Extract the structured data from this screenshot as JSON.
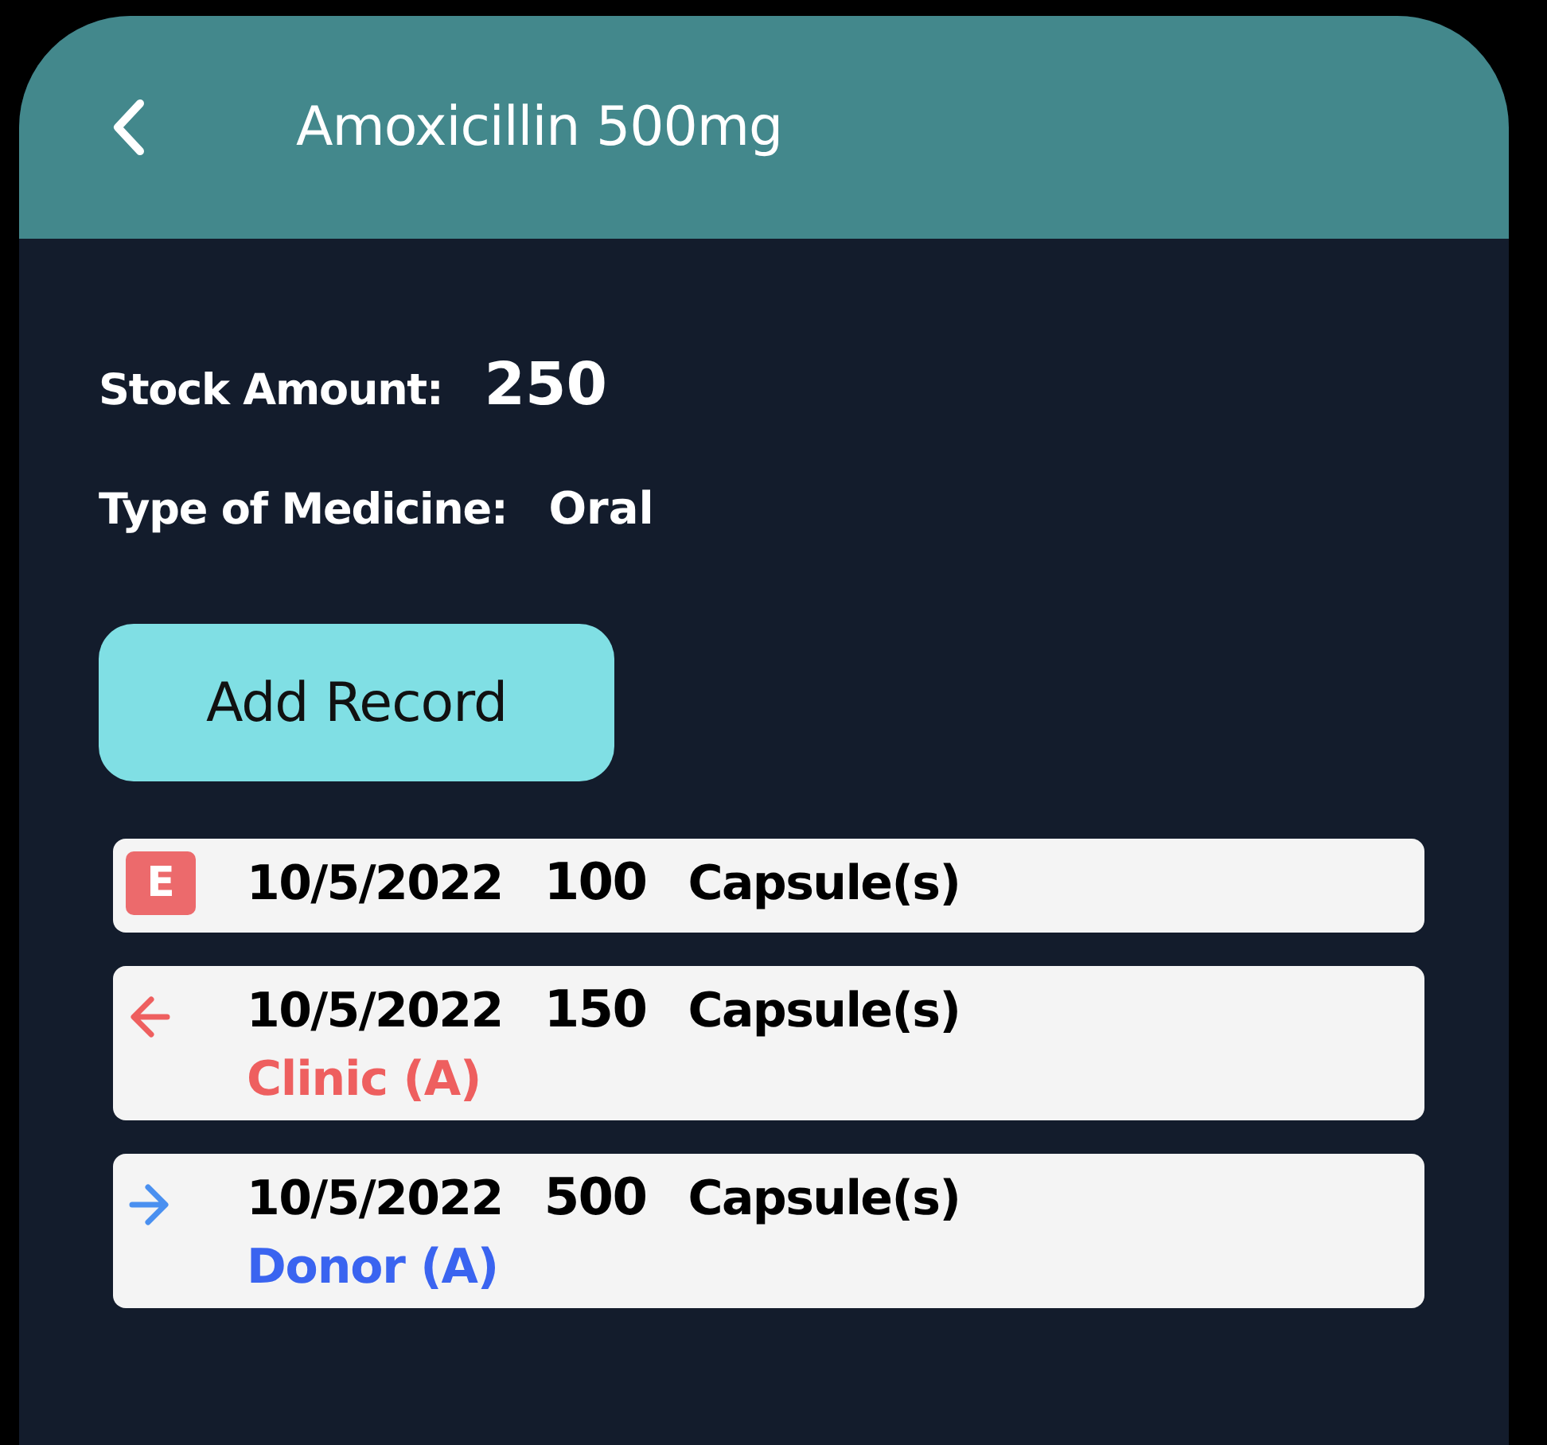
{
  "header": {
    "title": "Amoxicillin 500mg"
  },
  "stock": {
    "label": "Stock Amount:",
    "value": "250"
  },
  "type": {
    "label": "Type of Medicine:",
    "value": "Oral"
  },
  "add_button": {
    "label": "Add Record"
  },
  "records": [
    {
      "kind": "expired",
      "badge": "E",
      "date": "10/5/2022",
      "amount": "100",
      "unit": "Capsule(s)"
    },
    {
      "kind": "outgoing",
      "date": "10/5/2022",
      "amount": "150",
      "unit": "Capsule(s)",
      "party": "Clinic (A)"
    },
    {
      "kind": "incoming",
      "date": "10/5/2022",
      "amount": "500",
      "unit": "Capsule(s)",
      "party": "Donor (A)"
    }
  ]
}
